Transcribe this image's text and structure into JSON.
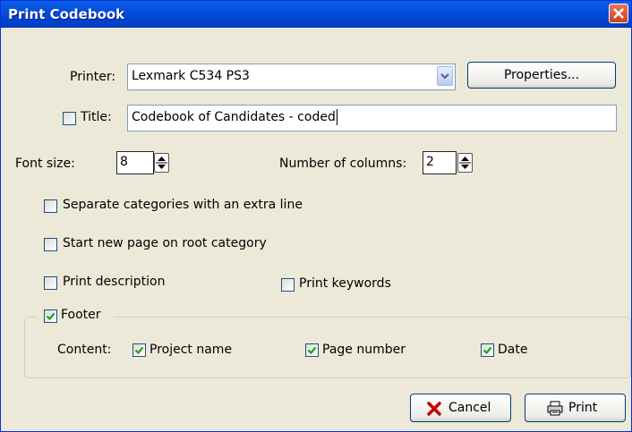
{
  "window": {
    "title": "Print Codebook"
  },
  "printer": {
    "label": "Printer:",
    "value": "Lexmark C534 PS3",
    "properties_label": "Properties..."
  },
  "title_opt": {
    "label": "Title:",
    "value": "Codebook of Candidates - coded",
    "checked": false
  },
  "font_size": {
    "label": "Font size:",
    "value": "8"
  },
  "columns": {
    "label": "Number of columns:",
    "value": "2"
  },
  "options": {
    "separate": {
      "label": "Separate categories with an extra line",
      "checked": false
    },
    "new_page": {
      "label": "Start new page on root category",
      "checked": false
    },
    "description": {
      "label": "Print description",
      "checked": false
    },
    "keywords": {
      "label": "Print keywords",
      "checked": false
    }
  },
  "footer": {
    "label": "Footer",
    "checked": true,
    "content_label": "Content:",
    "project_name": {
      "label": "Project name",
      "checked": true
    },
    "page_number": {
      "label": "Page number",
      "checked": true
    },
    "date": {
      "label": "Date",
      "checked": true
    }
  },
  "buttons": {
    "cancel": "Cancel",
    "print": "Print"
  },
  "colors": {
    "titlebar": "#0a5fe8",
    "dialog_bg": "#ece9d8",
    "check": "#21a121",
    "cancel_x": "#c40000"
  }
}
